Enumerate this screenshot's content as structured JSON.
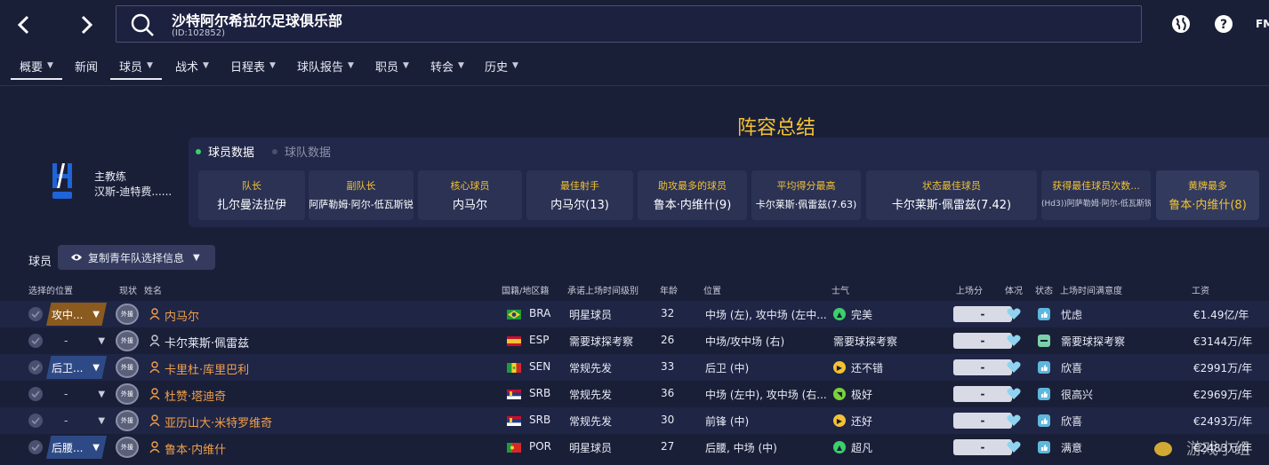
{
  "header": {
    "club_name": "沙特阿尔希拉尔足球俱乐部",
    "club_id": "(ID:102852)",
    "logo": "FM"
  },
  "tabs": [
    {
      "label": "概要",
      "has_menu": true,
      "active": true
    },
    {
      "label": "新闻",
      "has_menu": false,
      "active": false
    },
    {
      "label": "球员",
      "has_menu": true,
      "active": true
    },
    {
      "label": "战术",
      "has_menu": true,
      "active": false
    },
    {
      "label": "日程表",
      "has_menu": true,
      "active": false
    },
    {
      "label": "球队报告",
      "has_menu": true,
      "active": false
    },
    {
      "label": "职员",
      "has_menu": true,
      "active": false
    },
    {
      "label": "转会",
      "has_menu": true,
      "active": false
    },
    {
      "label": "历史",
      "has_menu": true,
      "active": false
    }
  ],
  "summary_title": "阵容总结",
  "manager": {
    "label": "主教练",
    "name": "汉斯-迪特费......"
  },
  "subtabs": [
    "球员数据",
    "球队数据"
  ],
  "cards": [
    {
      "label": "队长",
      "value": "扎尔曼法拉伊"
    },
    {
      "label": "副队长",
      "value": "阿萨勒姆·阿尔-低瓦斯锐"
    },
    {
      "label": "核心球员",
      "value": "内马尔"
    },
    {
      "label": "最佳射手",
      "value": "内马尔(13)"
    },
    {
      "label": "助攻最多的球员",
      "value": "鲁本·内维什(9)"
    },
    {
      "label": "平均得分最高",
      "value": "卡尔莱斯·佩雷兹(7.63)"
    },
    {
      "label": "状态最佳球员",
      "value": "卡尔莱斯·佩雷兹(7.42)"
    },
    {
      "label": "获得最佳球员次数...",
      "value": "(Hd3))阿萨勒姆·阿尔-低瓦斯锐(3)"
    },
    {
      "label": "黄牌最多",
      "value": "鲁本·内维什(8)"
    }
  ],
  "players_section": {
    "label": "球员",
    "copy_button": "复制青年队选择信息"
  },
  "columns": {
    "selected_position": "选择的位置",
    "state": "现状",
    "name": "姓名",
    "nationality": "国籍/地区籍",
    "level": "承诺上场时间级别",
    "age": "年龄",
    "position": "位置",
    "morale": "士气",
    "apps": "上场分",
    "condition": "体况",
    "status": "状态",
    "playing_time_satisfaction": "上场时间满意度",
    "wage": "工资"
  },
  "players": [
    {
      "selected_position": "攻中...",
      "pos_color": "#8a5a1e",
      "badge": "外援",
      "name": "内马尔",
      "name_color": "orange",
      "flag": "BRA",
      "nationality": "BRA",
      "level": "明星球员",
      "age": "32",
      "position": "中场 (左), 攻中场 (左中...",
      "morale_icon": "up",
      "morale_color": "#3ccf6a",
      "morale": "完美",
      "apps": "-",
      "status_icon": "thumbs-up",
      "satisfaction": "忧虑",
      "wage": "€1.49亿/年"
    },
    {
      "selected_position": "-",
      "pos_color": "",
      "badge": "外援",
      "name": "卡尔莱斯·佩雷兹",
      "name_color": "white",
      "flag": "ESP",
      "nationality": "ESP",
      "level": "需要球探考察",
      "age": "26",
      "position": "中场/攻中场 (右)",
      "morale_icon": "",
      "morale_color": "",
      "morale": "需要球探考察",
      "apps": "-",
      "status_icon": "minus",
      "satisfaction": "需要球探考察",
      "wage": "€3144万/年"
    },
    {
      "selected_position": "后卫...",
      "pos_color": "#2e4a86",
      "badge": "外援",
      "name": "卡里杜·库里巴利",
      "name_color": "orange",
      "flag": "SEN",
      "nationality": "SEN",
      "level": "常规先发",
      "age": "33",
      "position": "后卫 (中)",
      "morale_icon": "right",
      "morale_color": "#f3c233",
      "morale": "还不错",
      "apps": "-",
      "status_icon": "thumbs-up",
      "satisfaction": "欣喜",
      "wage": "€2991万/年"
    },
    {
      "selected_position": "-",
      "pos_color": "",
      "badge": "外援",
      "name": "杜赞·塔迪奇",
      "name_color": "orange",
      "flag": "SRB",
      "nationality": "SRB",
      "level": "常规先发",
      "age": "36",
      "position": "中场 (左中), 攻中场 (右...",
      "morale_icon": "up-right",
      "morale_color": "#7ad13c",
      "morale": "极好",
      "apps": "-",
      "status_icon": "thumbs-up",
      "satisfaction": "很高兴",
      "wage": "€2969万/年"
    },
    {
      "selected_position": "-",
      "pos_color": "",
      "badge": "外援",
      "name": "亚历山大·米特罗维奇",
      "name_color": "orange",
      "flag": "SRB",
      "nationality": "SRB",
      "level": "常规先发",
      "age": "30",
      "position": "前锋 (中)",
      "morale_icon": "right",
      "morale_color": "#f3c233",
      "morale": "还好",
      "apps": "-",
      "status_icon": "thumbs-up",
      "satisfaction": "欣喜",
      "wage": "€2493万/年"
    },
    {
      "selected_position": "后腰...",
      "pos_color": "#2e4a86",
      "badge": "外援",
      "name": "鲁本·内维什",
      "name_color": "orange",
      "flag": "POR",
      "nationality": "POR",
      "level": "明星球员",
      "age": "27",
      "position": "后腰, 中场 (中)",
      "morale_icon": "up",
      "morale_color": "#3ccf6a",
      "morale": "超凡",
      "apps": "-",
      "status_icon": "thumbs-up",
      "satisfaction": "满意",
      "wage": "€2483万/年"
    }
  ],
  "colors": {
    "background": "#1a1f38",
    "accent_yellow": "#f3c233",
    "name_orange": "#f0a04a",
    "panel": "#222849",
    "card": "#2b3254"
  },
  "watermark_text": "游戏小组"
}
